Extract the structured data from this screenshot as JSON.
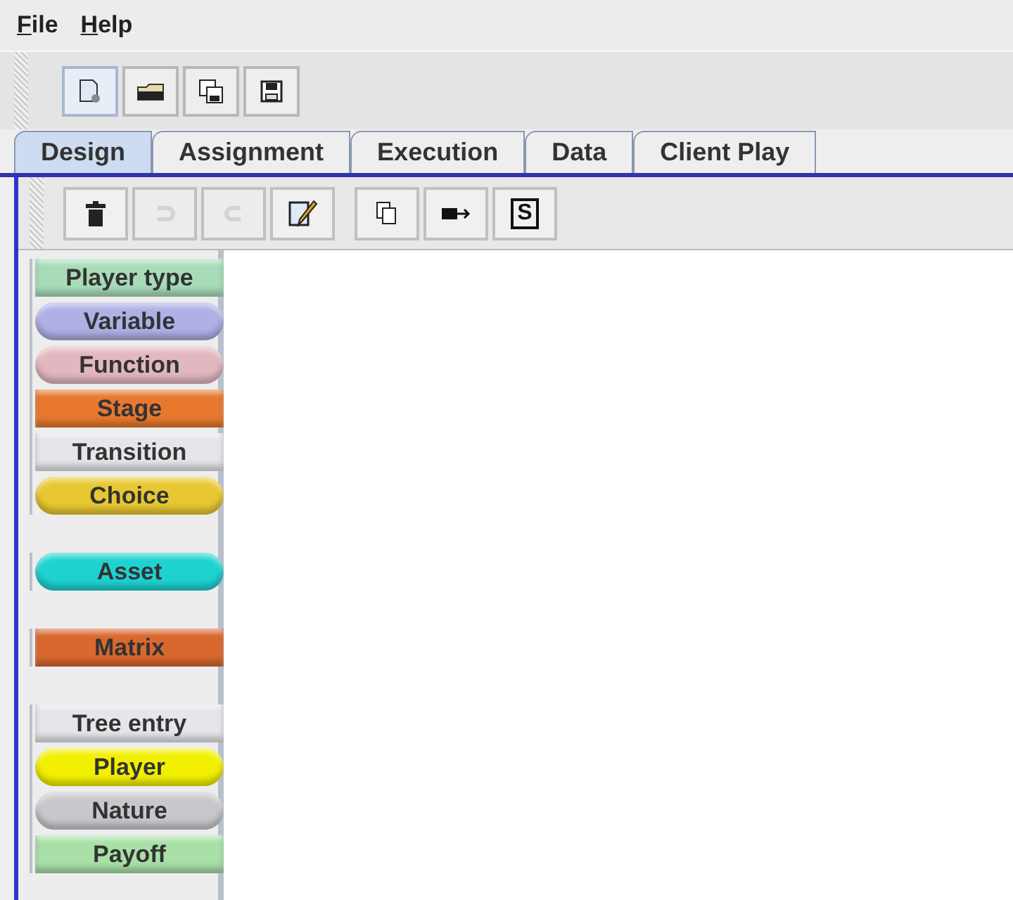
{
  "menu": [
    {
      "label": "File"
    },
    {
      "label": "Help"
    }
  ],
  "main_toolbar": [
    {
      "kind": "new",
      "selected": true
    },
    {
      "kind": "open",
      "selected": false
    },
    {
      "kind": "save-as",
      "selected": false
    },
    {
      "kind": "save",
      "selected": false
    }
  ],
  "tabs": [
    {
      "label": "Design",
      "selected": true
    },
    {
      "label": "Assignment",
      "selected": false
    },
    {
      "label": "Execution",
      "selected": false
    },
    {
      "label": "Data",
      "selected": false
    },
    {
      "label": "Client Play",
      "selected": false
    }
  ],
  "design_toolbar": [
    [
      {
        "kind": "delete",
        "disabled": false
      },
      {
        "kind": "redo",
        "disabled": true
      },
      {
        "kind": "undo",
        "disabled": true
      },
      {
        "kind": "edit",
        "disabled": false
      }
    ],
    [
      {
        "kind": "copy",
        "disabled": false
      },
      {
        "kind": "arrow",
        "disabled": false
      },
      {
        "kind": "text",
        "label": "S",
        "disabled": false
      }
    ]
  ],
  "palette": [
    [
      {
        "label": "Player type",
        "kind": "rect",
        "color": "#a8dcb8"
      },
      {
        "label": "Variable",
        "kind": "pill",
        "color": "#aeb0e6"
      },
      {
        "label": "Function",
        "kind": "pill",
        "color": "#e2b8c0"
      },
      {
        "label": "Stage",
        "kind": "rect",
        "color": "#e8782e"
      },
      {
        "label": "Transition",
        "kind": "rect",
        "color": "#e6e6ea"
      },
      {
        "label": "Choice",
        "kind": "pill",
        "color": "#e8c832"
      }
    ],
    [
      {
        "label": "Asset",
        "kind": "pill",
        "color": "#1ed2d2"
      }
    ],
    [
      {
        "label": "Matrix",
        "kind": "rect",
        "color": "#d8682e"
      }
    ],
    [
      {
        "label": "Tree entry",
        "kind": "rect",
        "color": "#e6e6ea"
      },
      {
        "label": "Player",
        "kind": "pill",
        "color": "#f2f000"
      },
      {
        "label": "Nature",
        "kind": "pill",
        "color": "#c8c8cc"
      },
      {
        "label": "Payoff",
        "kind": "rect",
        "color": "#a8e0a8"
      }
    ]
  ]
}
